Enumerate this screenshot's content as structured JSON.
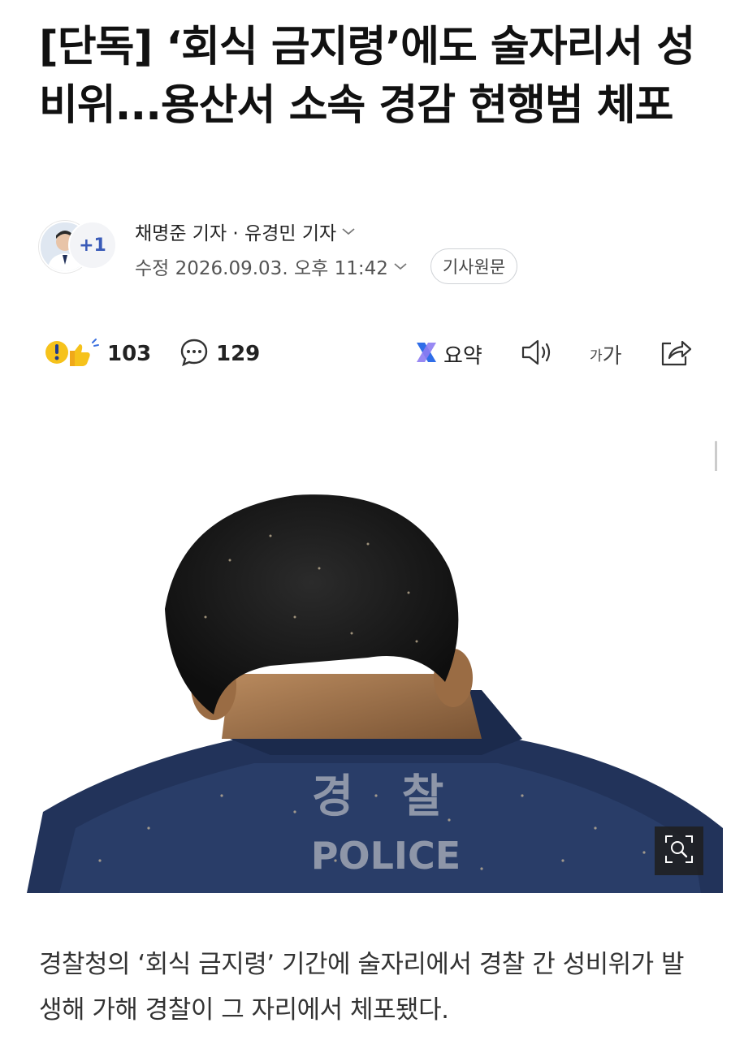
{
  "article": {
    "headline": "[단독] ‘회식 금지령’에도 술자리서 성비위...용산서 소속 경감 현행범 체포",
    "reporters": "채명준 기자 · 유경민 기자",
    "reporters_extra_badge": "+1",
    "modified_label": "수정 2026.09.03. 오후 11:42",
    "original_button": "기사원문",
    "caption": "경찰청의 ‘회식 금지령’ 기간에 술자리에서 경찰 간 성비위가 발생해 가해 경찰이 그 자리에서 체포됐다."
  },
  "actions": {
    "reaction_count": "103",
    "comment_count": "129",
    "summary_label": "요약",
    "font_small": "가",
    "font_large": "가"
  },
  "photo": {
    "text_korean": "경 찰",
    "text_english": "POLICE"
  },
  "colors": {
    "accent_blue": "#3a5bb8",
    "reaction_yellow": "#f6c21b",
    "uniform_navy": "#22335a"
  },
  "icons": [
    "reaction-icon",
    "comment-icon",
    "summary-icon",
    "audio-icon",
    "font-size-icon",
    "share-icon",
    "zoom-icon",
    "chevron-down-icon"
  ]
}
